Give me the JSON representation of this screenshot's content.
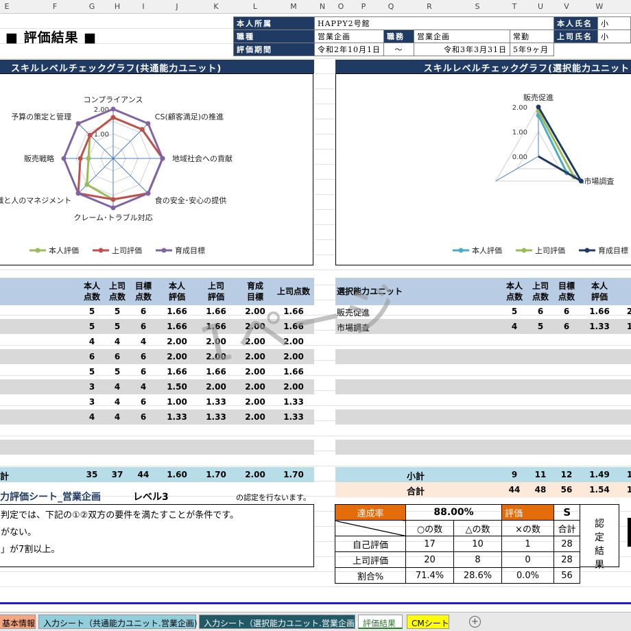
{
  "columns": [
    {
      "label": "E",
      "c": 10
    },
    {
      "label": "F",
      "c": 80
    },
    {
      "label": "G",
      "c": 134
    },
    {
      "label": "H",
      "c": 171
    },
    {
      "label": "I",
      "c": 209
    },
    {
      "label": "J",
      "c": 258
    },
    {
      "label": "K",
      "c": 315
    },
    {
      "label": "L",
      "c": 372
    },
    {
      "label": "M",
      "c": 428
    },
    {
      "label": "N",
      "c": 470
    },
    {
      "label": "O",
      "c": 497
    },
    {
      "label": "P",
      "c": 530
    },
    {
      "label": "Q",
      "c": 570
    },
    {
      "label": "R",
      "c": 626
    },
    {
      "label": "S",
      "c": 696
    },
    {
      "label": "T",
      "c": 750
    },
    {
      "label": "U",
      "c": 788
    },
    {
      "label": "V",
      "c": 826
    },
    {
      "label": "W",
      "c": 874
    }
  ],
  "title": "■ 評価結果 ■",
  "info": {
    "affiliation_label": "本人所属",
    "affiliation_value": "HAPPY2号館",
    "name_label": "本人氏名",
    "name_value": "小",
    "job_label": "職種",
    "job_value": "営業企画",
    "duty_label": "職務",
    "duty_value": "営業企画",
    "employment_value": "常勤",
    "boss_label": "上司氏名",
    "boss_value": "小",
    "period_label": "評価期間",
    "period_start": "令和2年10月1日",
    "period_sep": "〜",
    "period_end": "令和3年3月31日",
    "period_length": "5年9ヶ月"
  },
  "chart_common": {
    "header": "スキルレベルチェックグラフ(共通能力ユニット)",
    "type": "radar",
    "axes": [
      "コンプライアンス",
      "CS(顧客満足)の推進",
      "地域社会への貢献",
      "食の安全･安心の提供",
      "クレーム･トラブル対応",
      "組織と人のマネジメント",
      "販売戦略",
      "予算の策定と管理"
    ],
    "ticks": [
      "2.00",
      "1.00"
    ],
    "max": 2,
    "series": [
      {
        "name": "本人評価",
        "color": "#9bbb59",
        "values": [
          1.66,
          1.66,
          2.0,
          2.0,
          1.66,
          1.5,
          1.0,
          1.33
        ]
      },
      {
        "name": "上司評価",
        "color": "#c0504d",
        "values": [
          1.66,
          1.66,
          2.0,
          2.0,
          1.66,
          2.0,
          1.33,
          1.33
        ]
      },
      {
        "name": "育成目標",
        "color": "#8064a2",
        "values": [
          2.0,
          2.0,
          2.0,
          2.0,
          2.0,
          2.0,
          2.0,
          2.0
        ]
      }
    ]
  },
  "chart_select": {
    "header": "スキルレベルチェックグラフ(選択能力ユニット",
    "type": "radar",
    "axes": [
      "販売促進",
      "市場調査"
    ],
    "ticks": [
      "2.00",
      "1.00",
      "0.00"
    ],
    "max": 2,
    "series": [
      {
        "name": "本人評価",
        "color": "#4bacc6",
        "values": [
          1.66,
          1.33
        ]
      },
      {
        "name": "上司評価",
        "color": "#9bbb59",
        "values": [
          1.83,
          1.67
        ]
      },
      {
        "name": "育成目標",
        "color": "#1f3b63",
        "values": [
          2.0,
          2.0
        ]
      }
    ]
  },
  "left_table": {
    "headers": [
      "本人\n点数",
      "上司\n点数",
      "目標\n点数",
      "本人\n評価",
      "上司\n評価",
      "育成\n目標",
      "上司点数"
    ],
    "rows": [
      [
        "5",
        "5",
        "6",
        "1.66",
        "1.66",
        "2.00",
        "1.66"
      ],
      [
        "5",
        "5",
        "6",
        "1.66",
        "1.66",
        "2.00",
        "1.66"
      ],
      [
        "4",
        "4",
        "4",
        "2.00",
        "2.00",
        "2.00",
        "2.00"
      ],
      [
        "6",
        "6",
        "6",
        "2.00",
        "2.00",
        "2.00",
        "2.00"
      ],
      [
        "5",
        "5",
        "6",
        "1.66",
        "1.66",
        "2.00",
        "1.66"
      ],
      [
        "3",
        "4",
        "4",
        "1.50",
        "2.00",
        "2.00",
        "2.00"
      ],
      [
        "3",
        "4",
        "6",
        "1.00",
        "1.33",
        "2.00",
        "1.33"
      ],
      [
        "4",
        "4",
        "6",
        "1.33",
        "1.33",
        "2.00",
        "1.33"
      ]
    ],
    "subtotal_label": "計",
    "subtotal": [
      "35",
      "37",
      "44",
      "1.60",
      "1.70",
      "2.00",
      "1.70"
    ]
  },
  "right_table": {
    "unit_header": "選択能力ユニット",
    "headers": [
      "本人\n点数",
      "上司\n点数",
      "目標\n点数",
      "本人\n評価"
    ],
    "rows": [
      {
        "name": "販売促進",
        "vals": [
          "5",
          "6",
          "6",
          "1.66",
          "2"
        ]
      },
      {
        "name": "市場調査",
        "vals": [
          "4",
          "5",
          "6",
          "1.33",
          "1"
        ]
      }
    ],
    "subtotal_label": "小計",
    "subtotal": [
      "9",
      "11",
      "12",
      "1.49",
      "1"
    ],
    "total_label": "合計",
    "total": [
      "44",
      "48",
      "56",
      "1.54",
      "1"
    ]
  },
  "certification": {
    "sheet_name": "力評価シート_営業企画",
    "level": "レベル3",
    "suffix": "の認定を行ないます。",
    "lines": [
      "判定では、下記の①②双方の要件を満たすことが条件です。",
      "がない。",
      "」が7割以上。"
    ]
  },
  "stats": {
    "rate_label": "達成率",
    "rate_value": "88.00%",
    "eval_label": "評価",
    "eval_value": "S",
    "cert_label": "認定結果",
    "cols": [
      "○の数",
      "△の数",
      "×の数",
      "合計"
    ],
    "rows": [
      {
        "label": "自己評価",
        "vals": [
          "17",
          "10",
          "1",
          "28"
        ]
      },
      {
        "label": "上司評価",
        "vals": [
          "20",
          "8",
          "0",
          "28"
        ]
      },
      {
        "label": "割合%",
        "vals": [
          "71.4%",
          "28.6%",
          "0.0%",
          "56"
        ]
      }
    ]
  },
  "watermark": "1ページ",
  "tabs": [
    {
      "label": "基本情報",
      "bg": "#f4a582"
    },
    {
      "label": "入力シート（共通能力ユニット.営業企画)",
      "bg": "#92cddc"
    },
    {
      "label": "入力シート（選択能力ユニット.営業企画)",
      "bg": "#215967"
    },
    {
      "label": "評価結果",
      "bg": "#ffffff"
    },
    {
      "label": "CMシート",
      "bg": "#ffff00"
    }
  ]
}
